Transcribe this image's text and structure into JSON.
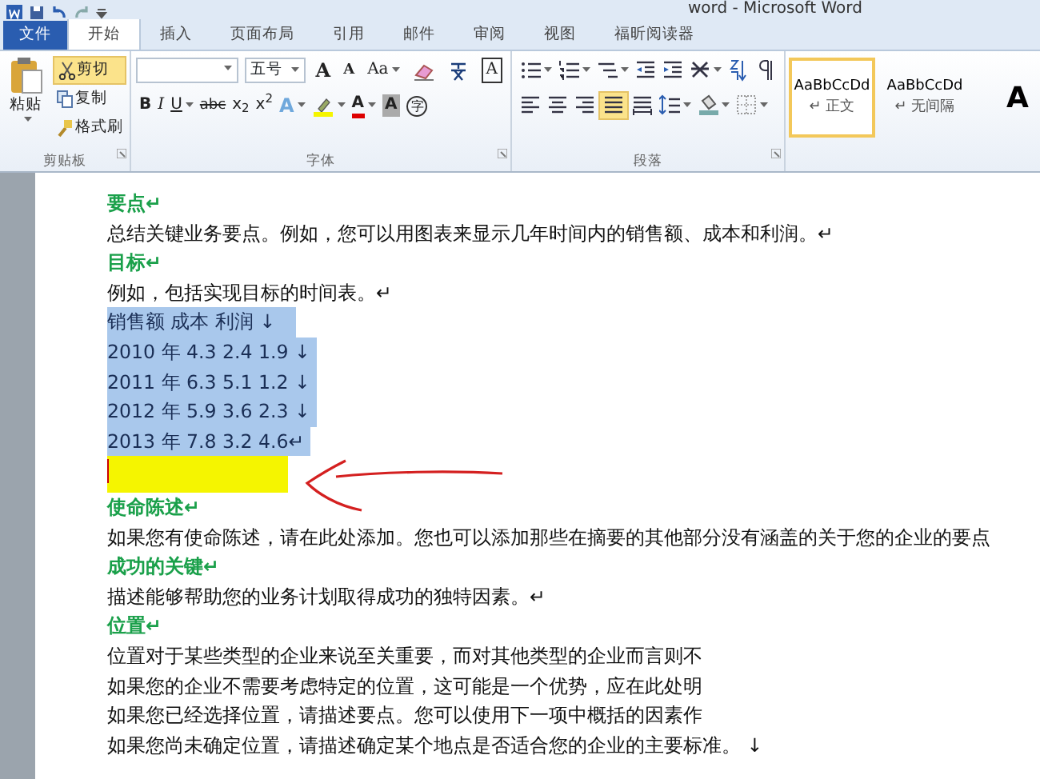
{
  "window": {
    "title": "word  -  Microsoft Word"
  },
  "tabs": [
    {
      "label": "文件",
      "kind": "file",
      "selected": false
    },
    {
      "label": "开始",
      "kind": "tab",
      "selected": true
    },
    {
      "label": "插入",
      "kind": "tab",
      "selected": false
    },
    {
      "label": "页面布局",
      "kind": "tab",
      "selected": false
    },
    {
      "label": "引用",
      "kind": "tab",
      "selected": false
    },
    {
      "label": "邮件",
      "kind": "tab",
      "selected": false
    },
    {
      "label": "审阅",
      "kind": "tab",
      "selected": false
    },
    {
      "label": "视图",
      "kind": "tab",
      "selected": false
    },
    {
      "label": "福昕阅读器",
      "kind": "tab",
      "selected": false
    }
  ],
  "clipboard": {
    "label": "剪贴板",
    "paste": "粘贴",
    "items": [
      {
        "label": "剪切",
        "kind": "cut",
        "highlighted": true
      },
      {
        "label": "复制",
        "kind": "copy",
        "highlighted": false
      },
      {
        "label": "格式刷",
        "kind": "brush",
        "highlighted": false
      }
    ]
  },
  "font": {
    "label": "字体",
    "size_field": "五号",
    "row1": [
      {
        "kind": "grow",
        "label": "A"
      },
      {
        "kind": "shrink",
        "label": "A"
      },
      {
        "kind": "case",
        "label": "Aa"
      },
      {
        "kind": "clear"
      },
      {
        "kind": "pinyin"
      },
      {
        "kind": "boxed",
        "label": "A"
      }
    ],
    "row2": [
      {
        "kind": "bold",
        "label": "B"
      },
      {
        "kind": "italic",
        "label": "I"
      },
      {
        "kind": "underline",
        "label": "U"
      },
      {
        "kind": "strike",
        "label": "abc"
      },
      {
        "kind": "sub",
        "label": "x$_{2}$"
      },
      {
        "kind": "sup",
        "label": "x$^{2}$"
      },
      {
        "kind": "effects",
        "label": "A"
      },
      {
        "kind": "highlighter"
      },
      {
        "kind": "color",
        "label": "A"
      },
      {
        "kind": "shade",
        "label": "A"
      },
      {
        "kind": "enclose",
        "label": "字"
      }
    ]
  },
  "paragraph": {
    "label": "段落",
    "row1": [
      {
        "kind": "bullets",
        "selected": false
      },
      {
        "kind": "numbering",
        "selected": false
      },
      {
        "kind": "multilevel",
        "selected": false
      },
      {
        "kind": "outdent",
        "selected": false
      },
      {
        "kind": "indent",
        "selected": false
      },
      {
        "kind": "chinese-layout",
        "selected": false
      },
      {
        "kind": "sort",
        "selected": false
      },
      {
        "kind": "marks",
        "selected": false
      }
    ],
    "row2": [
      {
        "kind": "left",
        "selected": false
      },
      {
        "kind": "center",
        "selected": false
      },
      {
        "kind": "right",
        "selected": false
      },
      {
        "kind": "justify",
        "selected": true
      },
      {
        "kind": "distribute",
        "selected": false
      },
      {
        "kind": "spacing",
        "selected": false
      },
      {
        "kind": "shading",
        "selected": false
      },
      {
        "kind": "borders",
        "selected": false
      }
    ]
  },
  "styles": [
    {
      "sample": "AaBbCcDd",
      "label": "↵ 正文",
      "selected": true
    },
    {
      "sample": "AaBbCcDd",
      "label": "↵ 无间隔",
      "selected": false
    },
    {
      "sample": "A",
      "selected": false
    }
  ],
  "document": [
    {
      "kind": "heading",
      "text": "要点↵"
    },
    {
      "kind": "body",
      "text": "总结关键业务要点。例如，您可以用图表来显示几年时间内的销售额、成本和利润。↵"
    },
    {
      "kind": "heading",
      "text": "目标↵"
    },
    {
      "kind": "body",
      "text": "例如，包括实现目标的时间表。↵"
    },
    {
      "kind": "table_row",
      "text": "销售额  成本  利润  ↓",
      "selected": true
    },
    {
      "kind": "table_row",
      "text": "2010 年  4.3 2.4 1.9  ↓",
      "selected": true
    },
    {
      "kind": "table_row",
      "text": "2011 年  6.3 5.1 1.2  ↓",
      "selected": true
    },
    {
      "kind": "table_row",
      "text": "2012 年  5.9 3.6 2.3  ↓",
      "selected": true
    },
    {
      "kind": "table_row",
      "text": "2013 年  7.8 3.2 4.6↵",
      "selected": true
    },
    {
      "kind": "highlight",
      "color": "#f5f500"
    },
    {
      "kind": "heading",
      "text": "使命陈述↵"
    },
    {
      "kind": "body",
      "text": "如果您有使命陈述，请在此处添加。您也可以添加那些在摘要的其他部分没有涵盖的关于您的企业的要点"
    },
    {
      "kind": "heading",
      "text": "成功的关键↵"
    },
    {
      "kind": "body",
      "text": "描述能够帮助您的业务计划取得成功的独特因素。↵"
    },
    {
      "kind": "heading",
      "text": "位置↵"
    },
    {
      "kind": "body",
      "text": "位置对于某些类型的企业来说至关重要，而对其他类型的企业而言则不"
    },
    {
      "kind": "body",
      "text": "如果您的企业不需要考虑特定的位置，这可能是一个优势，应在此处明"
    },
    {
      "kind": "body",
      "text": "如果您已经选择位置，请描述要点。您可以使用下一项中概括的因素作"
    },
    {
      "kind": "body",
      "text": "如果您尚未确定位置，请描述确定某个地点是否适合您的企业的主要标准。  ↓"
    }
  ]
}
